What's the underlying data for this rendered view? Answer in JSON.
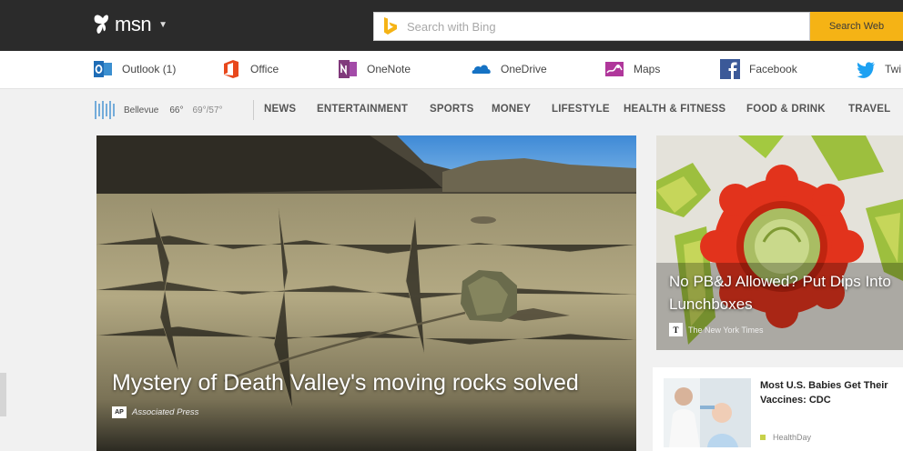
{
  "header": {
    "logo_text": "msn",
    "logo_icon": "butterfly-icon",
    "search_placeholder": "Search with Bing",
    "search_button": "Search Web",
    "accent_color": "#f5b315"
  },
  "apps": [
    {
      "label": "Outlook (1)",
      "icon": "outlook-icon"
    },
    {
      "label": "Office",
      "icon": "office-icon"
    },
    {
      "label": "OneNote",
      "icon": "onenote-icon"
    },
    {
      "label": "OneDrive",
      "icon": "onedrive-icon"
    },
    {
      "label": "Maps",
      "icon": "maps-icon"
    },
    {
      "label": "Facebook",
      "icon": "facebook-icon"
    },
    {
      "label": "Twi",
      "icon": "twitter-icon"
    }
  ],
  "weather": {
    "city": "Bellevue",
    "temp": "66°",
    "range": "69°/57°",
    "icon": "weather-rain-icon"
  },
  "nav": [
    "NEWS",
    "ENTERTAINMENT",
    "SPORTS",
    "MONEY",
    "LIFESTYLE",
    "HEALTH & FITNESS",
    "FOOD & DRINK",
    "TRAVEL"
  ],
  "hero": {
    "title": "Mystery of Death Valley's moving rocks solved",
    "source_badge": "AP",
    "source": "Associated Press"
  },
  "card1": {
    "title": "No PB&J Allowed? Put Dips Into Lunchboxes",
    "source_badge": "T",
    "source": "The New York Times"
  },
  "card2": {
    "title": "Most U.S. Babies Get Their Vaccines: CDC",
    "source": "HealthDay"
  }
}
